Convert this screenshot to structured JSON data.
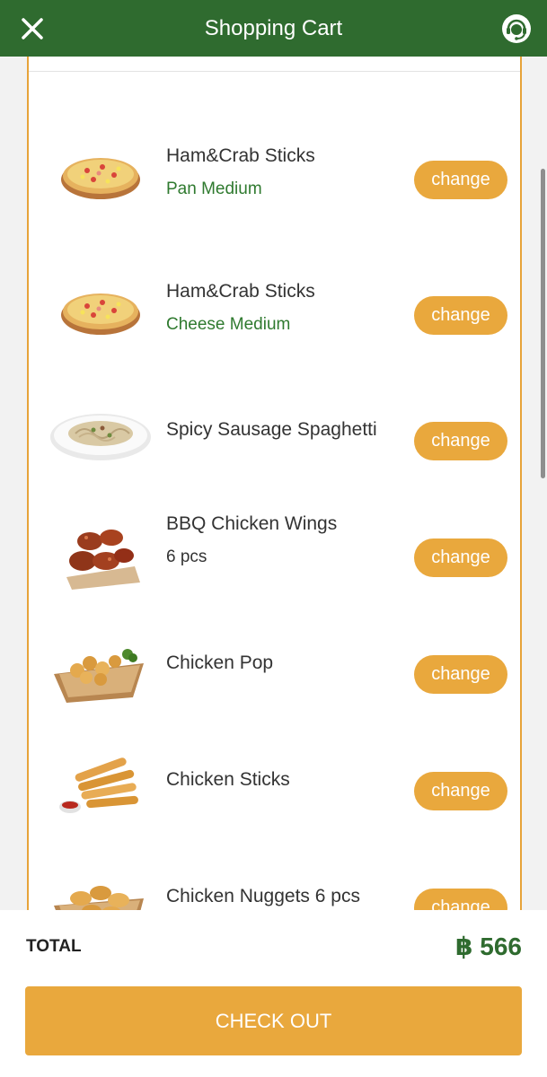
{
  "header": {
    "title": "Shopping Cart",
    "close_icon": "close-icon",
    "support_icon": "headset-support-icon"
  },
  "cart": {
    "change_label": "change",
    "items": [
      {
        "name": "Ham&Crab Sticks",
        "option": "Pan Medium",
        "image": "pizza-image"
      },
      {
        "name": "Ham&Crab Sticks",
        "option": "Cheese Medium",
        "image": "pizza-image"
      },
      {
        "name": "Spicy Sausage Spaghetti",
        "option": "",
        "image": "spaghetti-image"
      },
      {
        "name": "BBQ Chicken Wings",
        "option": "6 pcs",
        "image": "chicken-wings-image"
      },
      {
        "name": "Chicken Pop",
        "option": "",
        "image": "chicken-pop-image"
      },
      {
        "name": "Chicken Sticks",
        "option": "",
        "image": "chicken-sticks-image"
      },
      {
        "name": "Chicken Nuggets 6 pcs",
        "option": "",
        "image": "chicken-nuggets-image"
      }
    ]
  },
  "footer": {
    "total_label": "TOTAL",
    "total_value": "฿ 566",
    "checkout_label": "CHECK OUT"
  },
  "colors": {
    "header_green": "#2f6b2f",
    "accent_orange": "#e9a83d",
    "option_green": "#2f7a2f"
  }
}
